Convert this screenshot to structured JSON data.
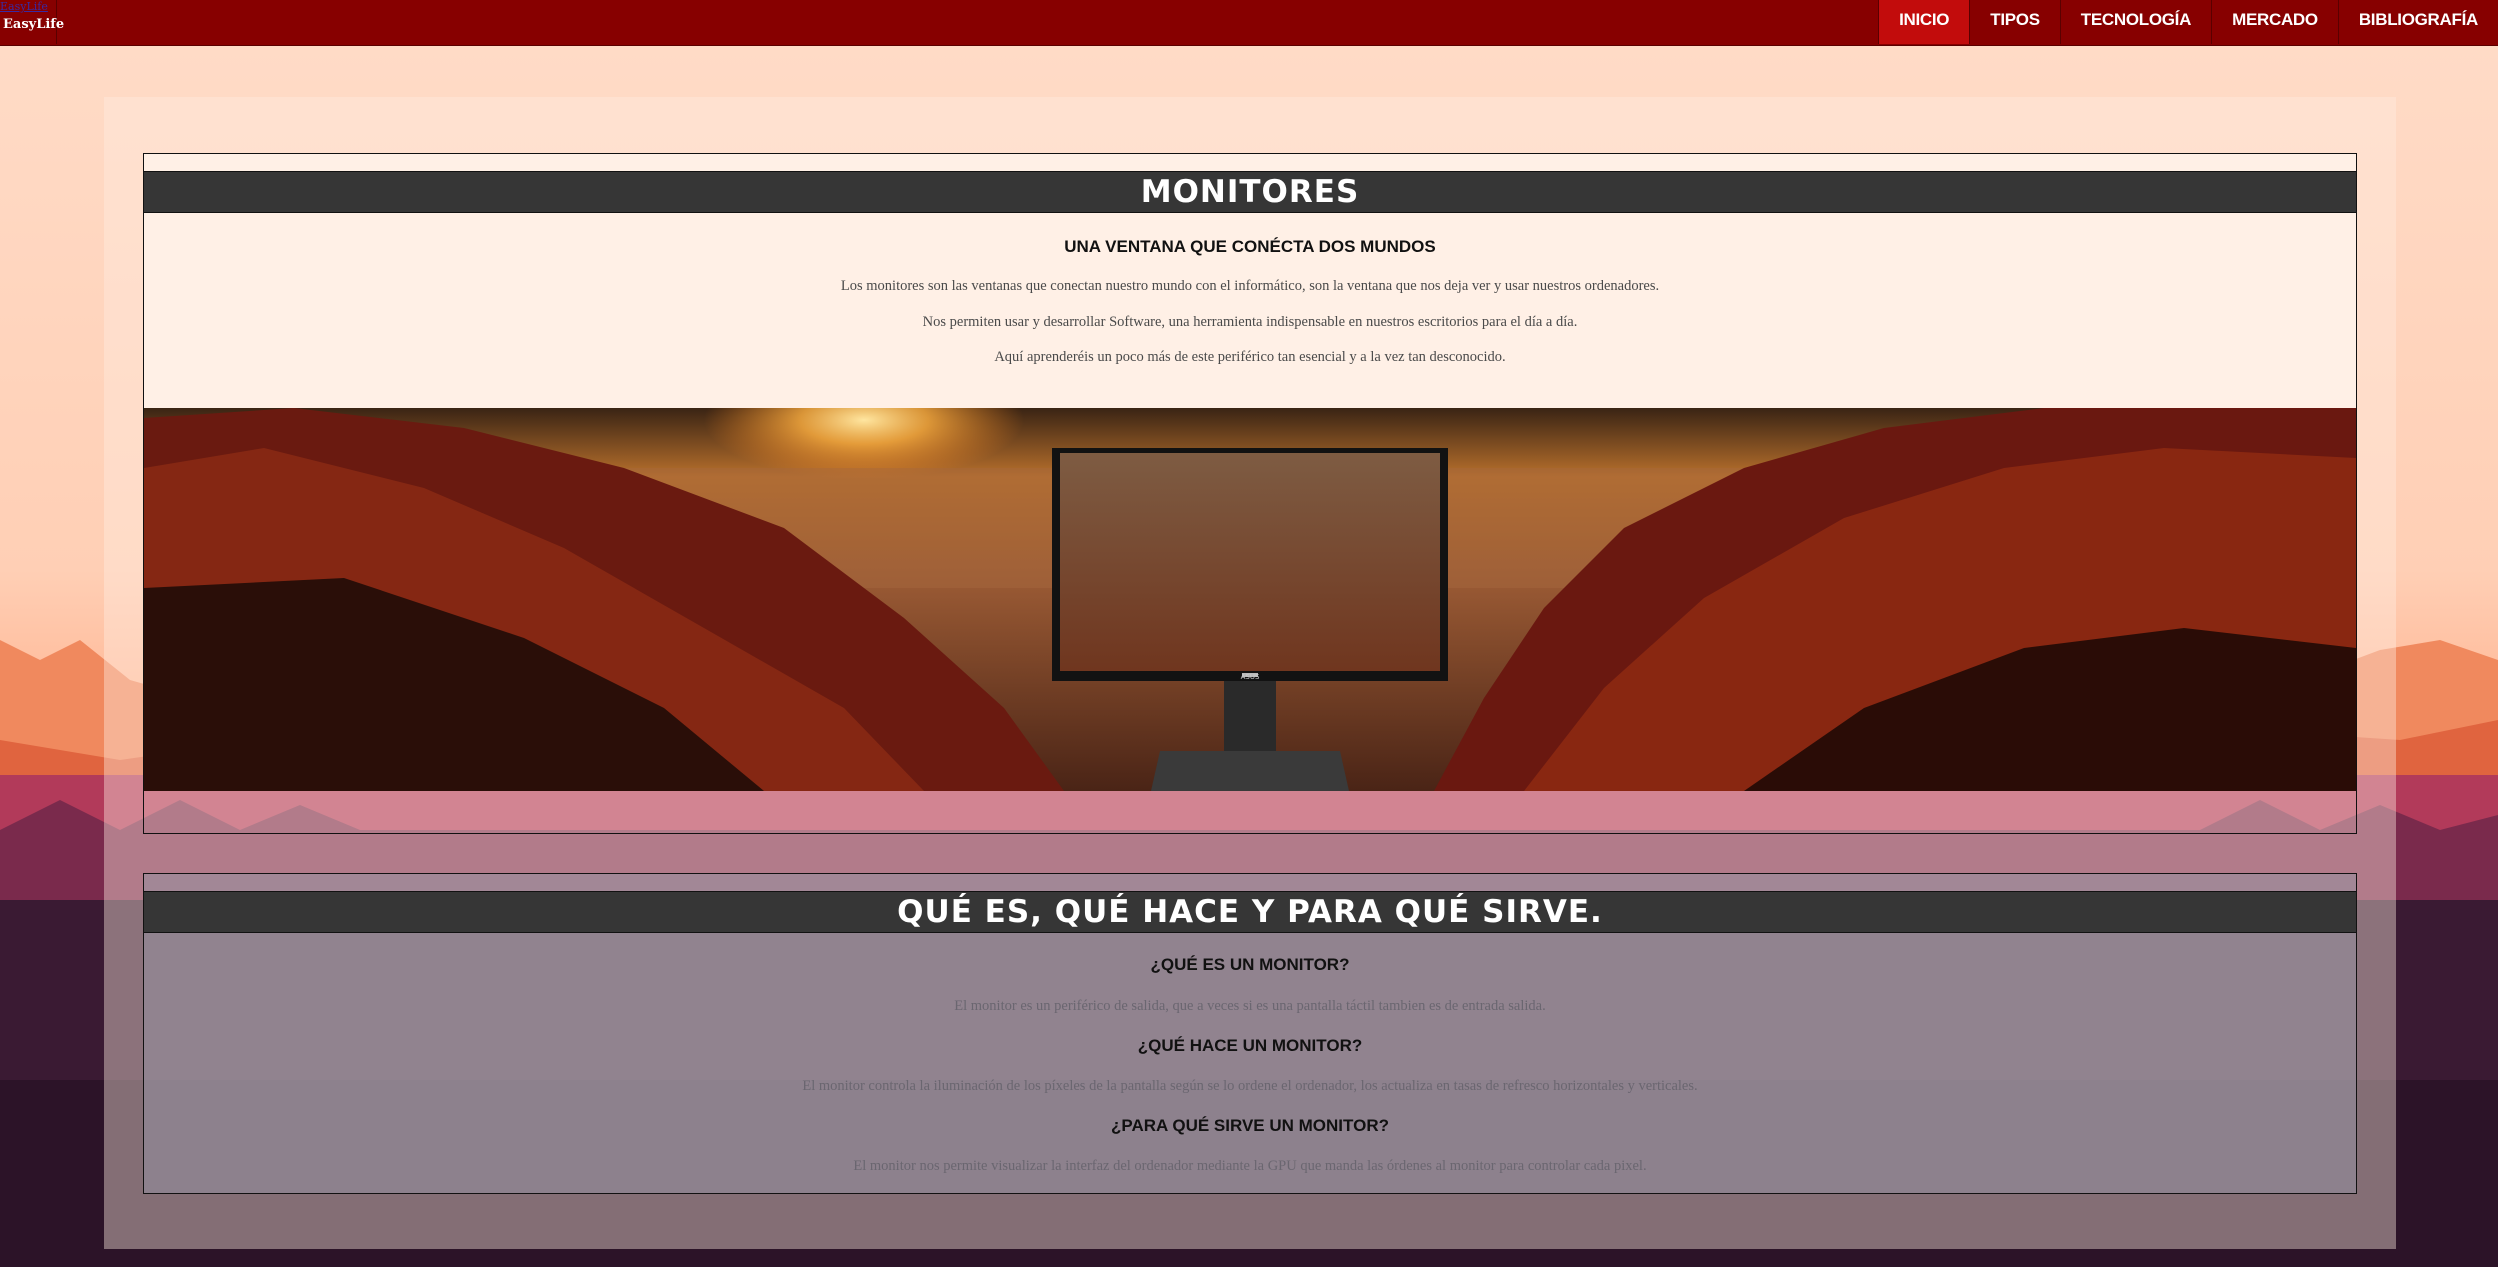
{
  "brand": {
    "logo_alt": "EasyLife",
    "name": "EasyLife"
  },
  "nav": {
    "items": [
      "INICIO",
      "TIPOS",
      "TECNOLOGÍA",
      "MERCADO",
      "BIBLIOGRAFÍA"
    ],
    "active": "INICIO"
  },
  "hero": {
    "title": "MONITORES",
    "subtitle": "UNA VENTANA QUE CONÉCTA DOS MUNDOS",
    "paragraphs": [
      "Los monitores son las ventanas que conectan nuestro mundo con el informático, son la ventana que nos deja ver y usar nuestros ordenadores.",
      "Nos permiten usar y desarrollar Software, una herramienta indispensable en nuestros escritorios para el día a día.",
      "Aquí aprenderéis un poco más de este periférico tan esencial y a la vez tan desconocido."
    ],
    "monitor_brand": "ASUS"
  },
  "about": {
    "title": "QUÉ ES, QUÉ HACE Y PARA QUÉ SIRVE.",
    "sections": [
      {
        "heading": "¿QUÉ ES UN MONITOR?",
        "text": "El monitor es un periférico de salida, que a veces si es una pantalla táctil tambien es de entrada salida."
      },
      {
        "heading": "¿QUÉ HACE UN MONITOR?",
        "text": "El monitor controla la iluminación de los píxeles de la pantalla según se lo ordene el ordenador, los actualiza en tasas de refresco horizontales y verticales."
      },
      {
        "heading": "¿PARA QUÉ SIRVE UN MONITOR?",
        "text": "El monitor nos permite visualizar la interfaz del ordenador mediante la GPU que manda las órdenes al monitor para controlar cada pixel."
      }
    ]
  },
  "colors": {
    "navbar": "#870000",
    "nav_active": "#c20c0c",
    "title_bar": "#363636"
  }
}
